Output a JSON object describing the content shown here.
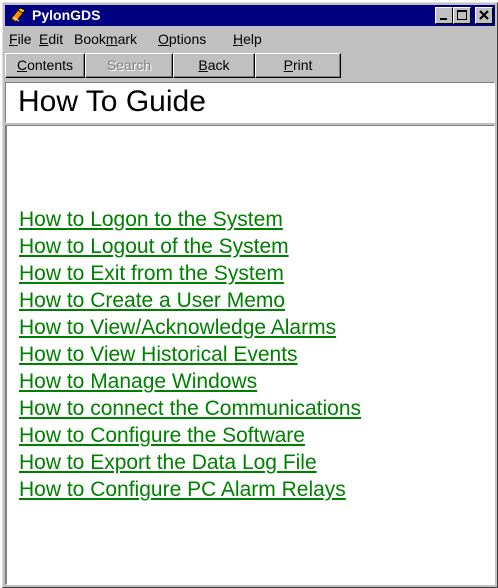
{
  "window": {
    "title": "PylonGDS",
    "icon": "pylon-app-icon",
    "controls": {
      "minimize": "minimize-icon",
      "maximize": "maximize-icon",
      "close": "close-icon"
    }
  },
  "menu": {
    "items": [
      {
        "label": "File",
        "accel": "F",
        "rest": "ile"
      },
      {
        "label": "Edit",
        "accel": "E",
        "rest": "dit"
      },
      {
        "label": "Bookmark",
        "pre": "Book",
        "accel": "m",
        "rest": "ark"
      },
      {
        "label": "Options",
        "accel": "O",
        "rest": "ptions"
      },
      {
        "label": "Help",
        "accel": "H",
        "rest": "elp"
      }
    ]
  },
  "toolbar": {
    "contents": {
      "label": "Contents",
      "accel": "C",
      "rest": "ontents",
      "enabled": true
    },
    "search": {
      "label": "Search",
      "enabled": false
    },
    "back": {
      "label": "Back",
      "accel": "B",
      "rest": "ack",
      "enabled": true
    },
    "print": {
      "label": "Print",
      "accel": "P",
      "rest": "rint",
      "enabled": true
    }
  },
  "heading": "How To Guide",
  "topics": [
    "How to Logon to the System",
    "How to Logout of the System",
    "How to Exit from the System",
    "How to Create a User Memo",
    "How to View/Acknowledge Alarms",
    "How to View Historical Events",
    "How to Manage Windows",
    "How to connect the Communications",
    "How to Configure the Software",
    "How to Export the Data Log File",
    "How to Configure PC Alarm Relays"
  ],
  "colors": {
    "titlebar": "#000080",
    "link": "#008000",
    "face": "#c0c0c0"
  }
}
